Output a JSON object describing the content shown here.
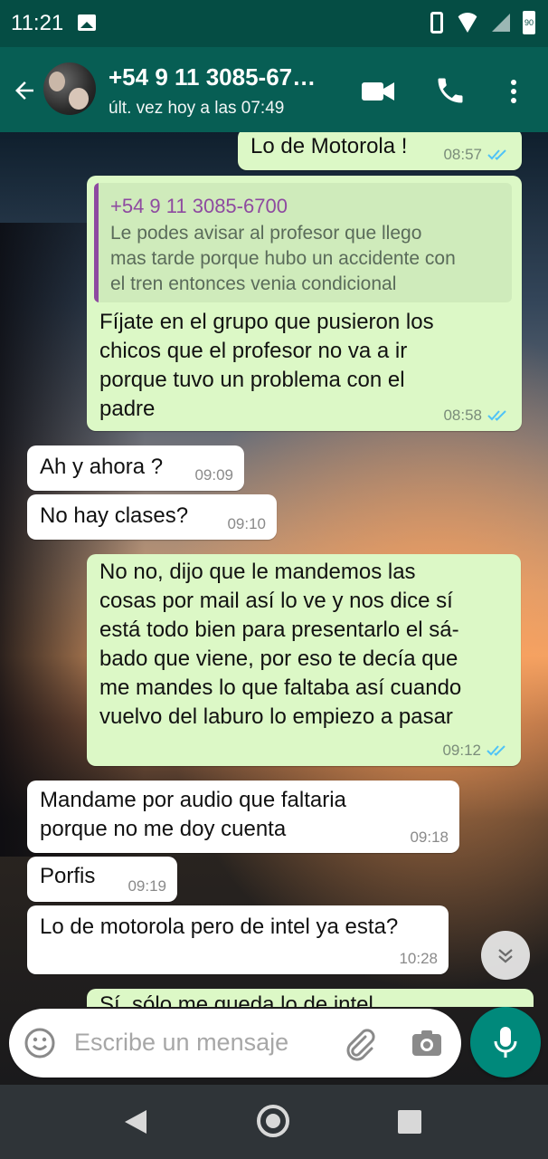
{
  "status_bar": {
    "time": "11:21",
    "battery": "90"
  },
  "header": {
    "contact": "+54 9 11 3085-67…",
    "last_seen": "últ. vez hoy a las 07:49"
  },
  "messages": [
    {
      "dir": "out",
      "text": "Lo de Motorola !",
      "time": "08:57"
    },
    {
      "dir": "out",
      "quote_name": "+54 9 11 3085-6700",
      "quote_text": "Le podes avisar al profesor que llego\nmas tarde porque hubo un accidente con\nel tren entonces venia condicional",
      "text": "Fíjate en el grupo que pusieron los\nchicos que el profesor no va a ir\nporque tuvo un problema con el\npadre",
      "time": "08:58"
    },
    {
      "dir": "in",
      "text": "Ah y ahora ?",
      "time": "09:09"
    },
    {
      "dir": "in",
      "text": "No hay clases?",
      "time": "09:10"
    },
    {
      "dir": "out",
      "text": "No no, dijo que le mandemos las\ncosas por mail así lo ve y nos dice sí\nestá todo bien para presentarlo el sá-\nbado que viene, por eso te decía que\nme mandes lo que faltaba así cuando\nvuelvo del laburo lo empiezo a pasar",
      "time": "09:12"
    },
    {
      "dir": "in",
      "text": "Mandame por audio que faltaria\nporque no me doy cuenta",
      "time": "09:18"
    },
    {
      "dir": "in",
      "text": "Porfis",
      "time": "09:19"
    },
    {
      "dir": "in",
      "text": "Lo de motorola pero de intel ya esta?",
      "time": "10:28"
    },
    {
      "dir": "out",
      "text": "Sí, sólo me queda lo de intel"
    }
  ],
  "composer": {
    "placeholder": "Escribe un mensaje"
  },
  "colors": {
    "header": "#075e54",
    "outgoing": "#dcf8c6",
    "incoming": "#ffffff",
    "accent": "#00897b",
    "ticks": "#4fc3f7"
  },
  "icons": [
    "back-arrow-icon",
    "video-call-icon",
    "phone-icon",
    "more-options-icon",
    "double-check-icon",
    "chevron-down-double-icon",
    "emoji-icon",
    "attach-icon",
    "camera-icon",
    "mic-icon"
  ]
}
